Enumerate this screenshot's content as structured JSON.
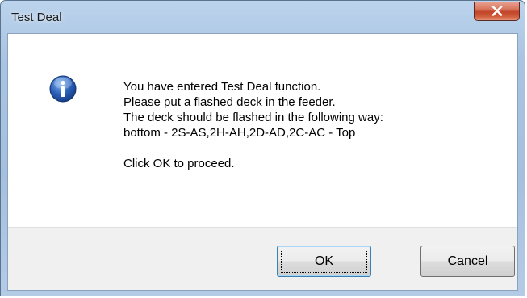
{
  "window": {
    "title": "Test Deal"
  },
  "dialog": {
    "icon": "info-icon",
    "message_lines": [
      "You have entered Test Deal function.",
      "Please put a flashed deck in the feeder.",
      "The deck should be flashed in the following way:",
      "bottom - 2S-AS,2H-AH,2D-AD,2C-AC - Top"
    ],
    "instruction": "Click OK to proceed."
  },
  "buttons": {
    "ok_label": "OK",
    "cancel_label": "Cancel"
  },
  "colors": {
    "close_button": "#c9503a",
    "info_icon": "#2a5fb8",
    "frame": "#a9c4e2"
  }
}
